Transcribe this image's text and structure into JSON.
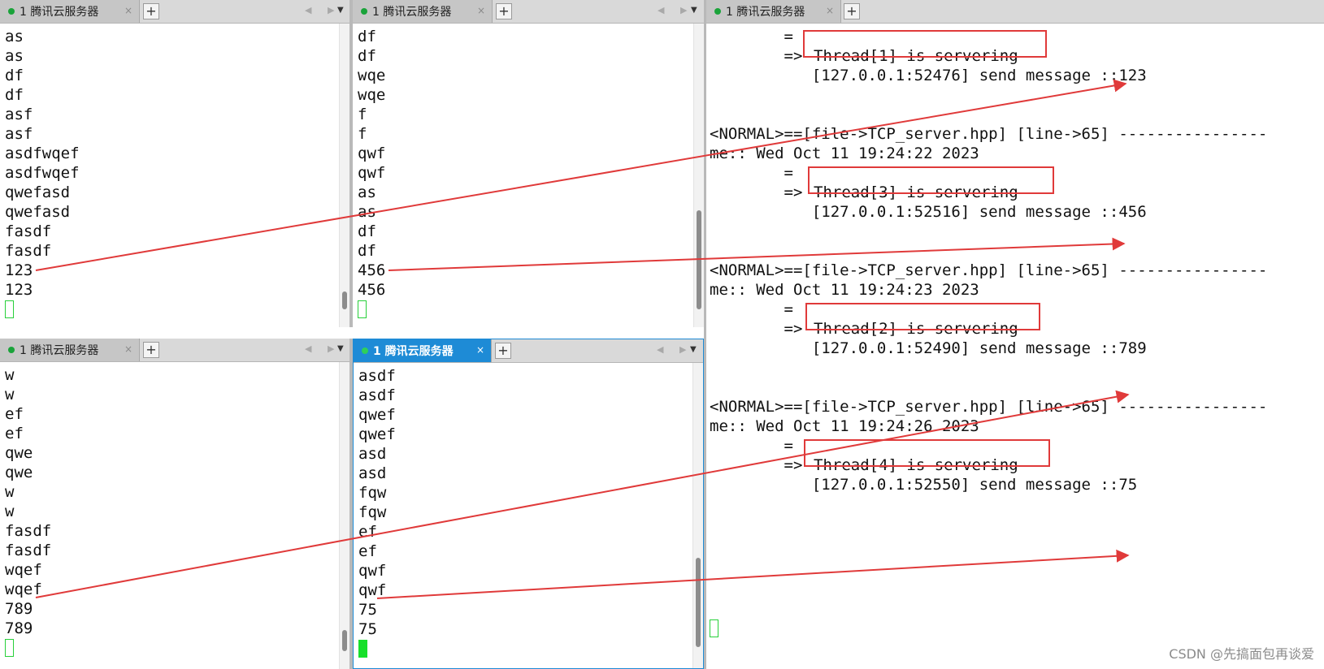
{
  "tabs": {
    "pane_tl": "1 腾讯云服务器",
    "pane_tr": "1 腾讯云服务器",
    "pane_bl": "1 腾讯云服务器",
    "pane_br": "1 腾讯云服务器",
    "pane_right": "1 腾讯云服务器",
    "close_glyph": "×",
    "add_glyph": "+",
    "nav_glyph": "◀ ▶",
    "menu_glyph": "▼"
  },
  "terminals": {
    "top_left": [
      "as",
      "as",
      "df",
      "df",
      "asf",
      "asf",
      "asdfwqef",
      "asdfwqef",
      "qwefasd",
      "qwefasd",
      "fasdf",
      "fasdf",
      "123",
      "123"
    ],
    "top_middle": [
      "df",
      "df",
      "wqe",
      "wqe",
      "f",
      "f",
      "qwf",
      "qwf",
      "as",
      "as",
      "df",
      "df",
      "456",
      "456"
    ],
    "bottom_left": [
      "w",
      "w",
      "ef",
      "ef",
      "qwe",
      "qwe",
      "w",
      "w",
      "fasdf",
      "fasdf",
      "wqef",
      "wqef",
      "789",
      "789"
    ],
    "bottom_middle": [
      "asdf",
      "asdf",
      "qwef",
      "qwef",
      "asd",
      "asd",
      "fqw",
      "fqw",
      "ef",
      "ef",
      "qwf",
      "qwf",
      "75",
      "75"
    ]
  },
  "server_log": {
    "lines": [
      "        =",
      "        =>",
      "           [127.0.0.1:52476] send message ::123",
      "",
      "",
      "<NORMAL>==[file->TCP_server.hpp] [line->65] ----------------",
      "me:: Wed Oct 11 19:24:22 2023",
      "        =",
      "        =>",
      "           [127.0.0.1:52516] send message ::456",
      "",
      "",
      "<NORMAL>==[file->TCP_server.hpp] [line->65] ----------------",
      "me:: Wed Oct 11 19:24:23 2023",
      "        =",
      "        =>",
      "           [127.0.0.1:52490] send message ::789",
      "",
      "",
      "<NORMAL>==[file->TCP_server.hpp] [line->65] ----------------",
      "me:: Wed Oct 11 19:24:26 2023",
      "        =",
      "        =>",
      "           [127.0.0.1:52550] send message ::75"
    ],
    "threads": [
      "Thread[1] is servering",
      "Thread[3] is servering",
      "Thread[2] is servering",
      "Thread[4] is servering"
    ]
  },
  "watermark": "CSDN @先搞面包再谈爱",
  "colors": {
    "accent_tab": "#1e8bd6",
    "annotation_red": "#e03a3a",
    "cursor_green": "#17e02a"
  }
}
